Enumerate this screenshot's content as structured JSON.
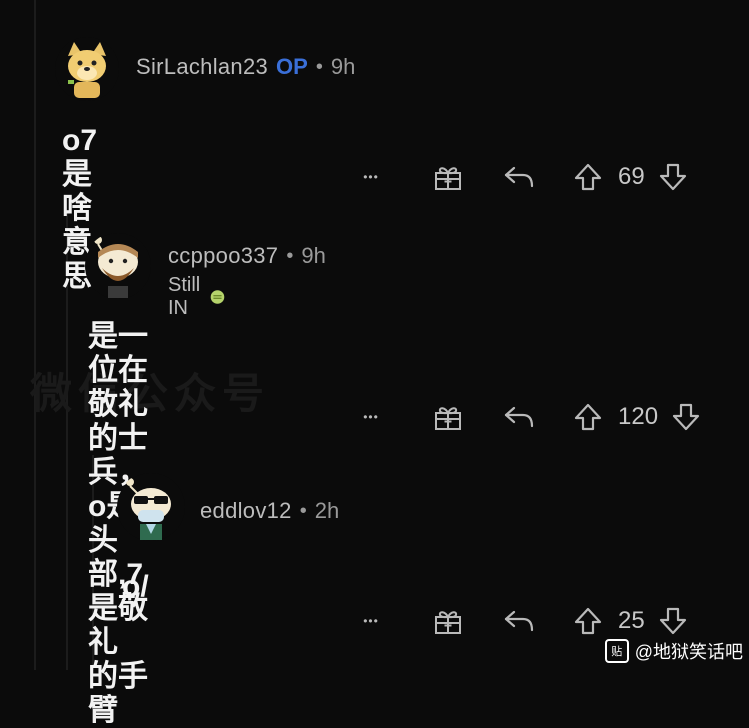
{
  "comments": [
    {
      "username": "SirLachlan23",
      "op_badge": "OP",
      "separator": "•",
      "time": "9h",
      "body": "o7是啥意思",
      "more": "•••",
      "votes": "69",
      "avatar_icon": "doge-avatar-icon"
    },
    {
      "username": "ccppoo337",
      "separator": "•",
      "time": "9h",
      "flair": "Still IN",
      "body_lines": [
        "是一位在敬礼的士兵，o是头部,7是敬礼",
        "的手臂"
      ],
      "more": "•••",
      "votes": "120",
      "avatar_icon": "bearded-avatar-icon"
    },
    {
      "username": "eddlov12",
      "separator": "•",
      "time": "2h",
      "body": "o/",
      "more": "•••",
      "votes": "25",
      "avatar_icon": "sunglasses-avatar-icon"
    }
  ],
  "watermark": {
    "badge": "贴",
    "text": "@地狱笑话吧"
  },
  "colors": {
    "background": "#0b0b0b",
    "op_blue": "#3a6fd8",
    "username": "#bdbdbd"
  }
}
